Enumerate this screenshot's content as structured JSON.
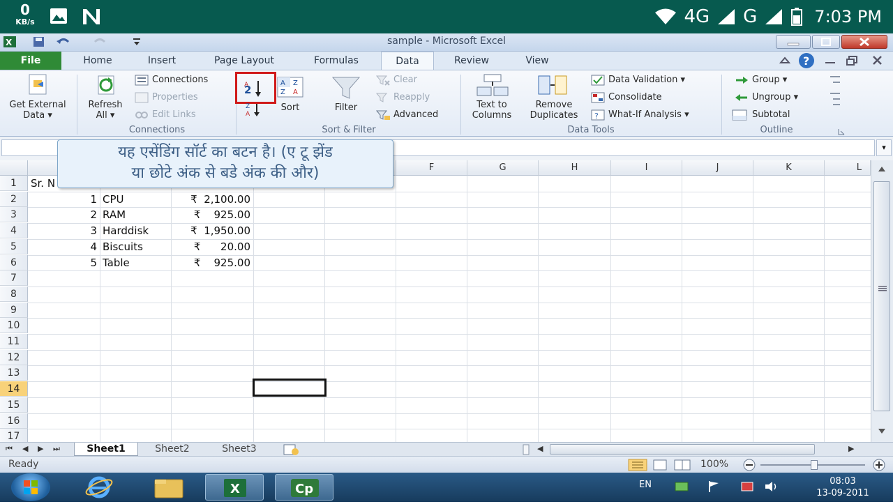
{
  "android_status": {
    "speed_value": "0",
    "speed_unit": "KB/s",
    "network_4g": "4G",
    "network_g": "G",
    "time": "7:03 PM"
  },
  "window": {
    "title": "sample - Microsoft Excel"
  },
  "ribbon_tabs": [
    "File",
    "Home",
    "Insert",
    "Page Layout",
    "Formulas",
    "Data",
    "Review",
    "View"
  ],
  "active_tab": "Data",
  "ribbon": {
    "get_external_line1": "Get External",
    "get_external_line2": "Data ▾",
    "refresh_line1": "Refresh",
    "refresh_line2": "All ▾",
    "connections": "Connections",
    "properties": "Properties",
    "edit_links": "Edit Links",
    "group_connections": "Connections",
    "sort": "Sort",
    "filter": "Filter",
    "clear": "Clear",
    "reapply": "Reapply",
    "advanced": "Advanced",
    "group_sort_filter": "Sort & Filter",
    "text_to_columns_line1": "Text to",
    "text_to_columns_line2": "Columns",
    "remove_duplicates_line1": "Remove",
    "remove_duplicates_line2": "Duplicates",
    "data_validation": "Data Validation ▾",
    "consolidate": "Consolidate",
    "what_if": "What-If Analysis ▾",
    "group_data_tools": "Data Tools",
    "group": "Group ▾",
    "ungroup": "Ungroup ▾",
    "subtotal": "Subtotal",
    "group_outline": "Outline"
  },
  "callout": {
    "line1": "यह एसेंडिंग सॉर्ट का बटन है। (ए टू झेंड",
    "line2": "या छोटे अंक से बडे अंक की और)"
  },
  "columns": [
    "F",
    "G",
    "H",
    "I",
    "J",
    "K",
    "L"
  ],
  "rows": [
    "1",
    "2",
    "3",
    "4",
    "5",
    "6",
    "7",
    "8",
    "9",
    "10",
    "11",
    "12",
    "13",
    "14",
    "15",
    "16",
    "17"
  ],
  "selected_row": "14",
  "sheet": {
    "a1": "Sr. N",
    "data": [
      {
        "sr": "1",
        "item": "CPU",
        "price": "₹  2,100.00"
      },
      {
        "sr": "2",
        "item": "RAM",
        "price": "₹    925.00"
      },
      {
        "sr": "3",
        "item": "Harddisk",
        "price": "₹  1,950.00"
      },
      {
        "sr": "4",
        "item": "Biscuits",
        "price": "₹      20.00"
      },
      {
        "sr": "5",
        "item": "Table",
        "price": "₹    925.00"
      }
    ]
  },
  "sheet_tabs": [
    "Sheet1",
    "Sheet2",
    "Sheet3"
  ],
  "statusbar": {
    "ready": "Ready",
    "zoom": "100%"
  },
  "taskbar": {
    "lang": "EN",
    "time": "08:03",
    "date": "13-09-2011"
  },
  "colors": {
    "android_bar": "#075a4f",
    "file_tab": "#2f8a36",
    "highlight_box": "#d01a1a",
    "selected_row": "#f8d27a",
    "taskbar": "#1f4a72"
  }
}
